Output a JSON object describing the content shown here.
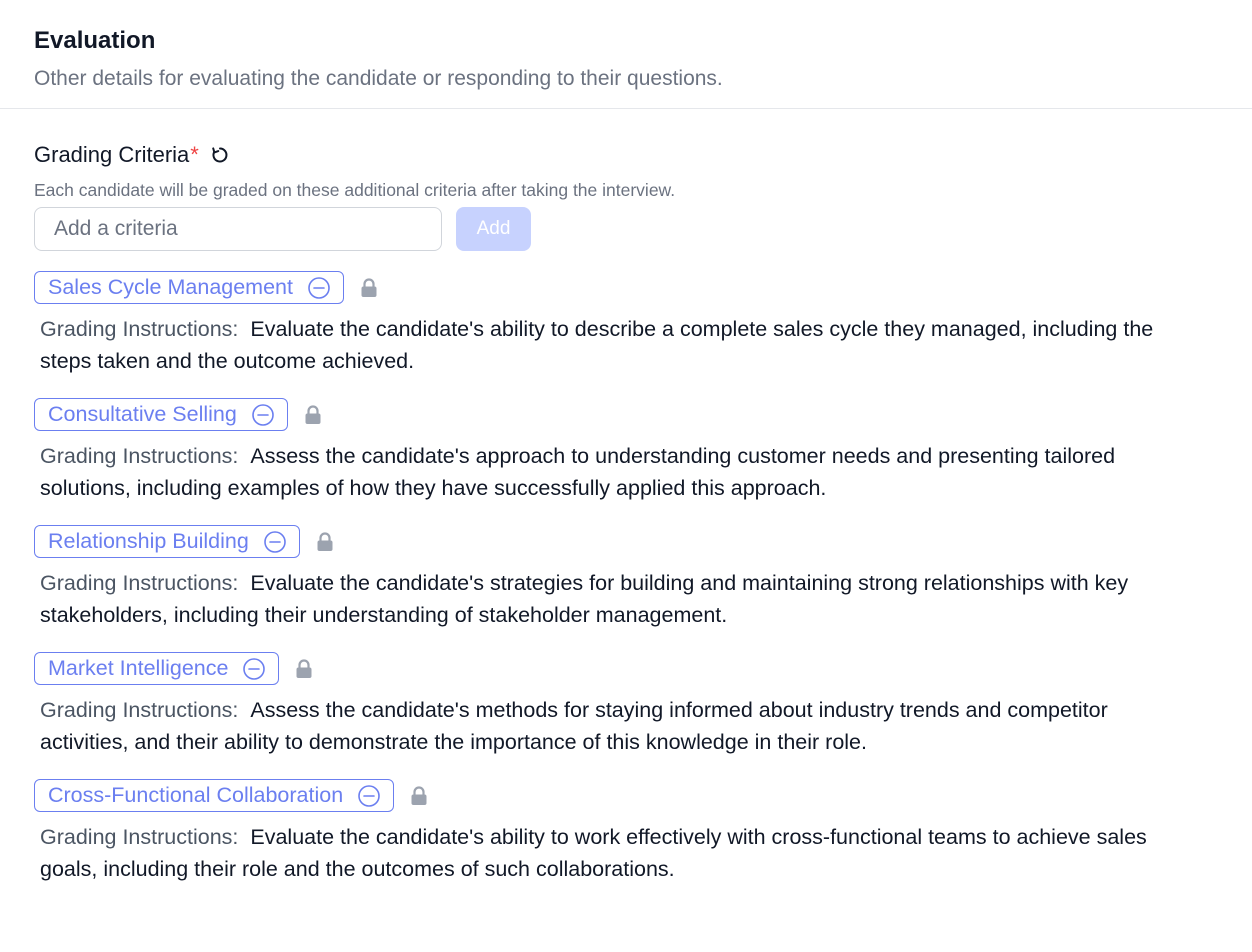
{
  "section": {
    "title": "Evaluation",
    "description": "Other details for evaluating the candidate or responding to their questions."
  },
  "grading": {
    "label": "Grading Criteria",
    "required_marker": "*",
    "help_text": "Each candidate will be graded on these additional criteria after taking the interview.",
    "input_placeholder": "Add a criteria",
    "add_label": "Add",
    "instructions_label": "Grading Instructions:",
    "icons": {
      "refresh": "refresh-icon",
      "remove": "minus-circle-icon",
      "lock": "lock-icon"
    },
    "colors": {
      "accent": "#6b7ff0",
      "required": "#ef4444",
      "add_button_disabled": "#c7d2fe"
    },
    "criteria": [
      {
        "name": "Sales Cycle Management",
        "instructions": "Evaluate the candidate's ability to describe a complete sales cycle they managed, including the steps taken and the outcome achieved."
      },
      {
        "name": "Consultative Selling",
        "instructions": "Assess the candidate's approach to understanding customer needs and presenting tailored solutions, including examples of how they have successfully applied this approach."
      },
      {
        "name": "Relationship Building",
        "instructions": "Evaluate the candidate's strategies for building and maintaining strong relationships with key stakeholders, including their understanding of stakeholder management."
      },
      {
        "name": "Market Intelligence",
        "instructions": "Assess the candidate's methods for staying informed about industry trends and competitor activities, and their ability to demonstrate the importance of this knowledge in their role."
      },
      {
        "name": "Cross-Functional Collaboration",
        "instructions": "Evaluate the candidate's ability to work effectively with cross-functional teams to achieve sales goals, including their role and the outcomes of such collaborations."
      }
    ]
  }
}
